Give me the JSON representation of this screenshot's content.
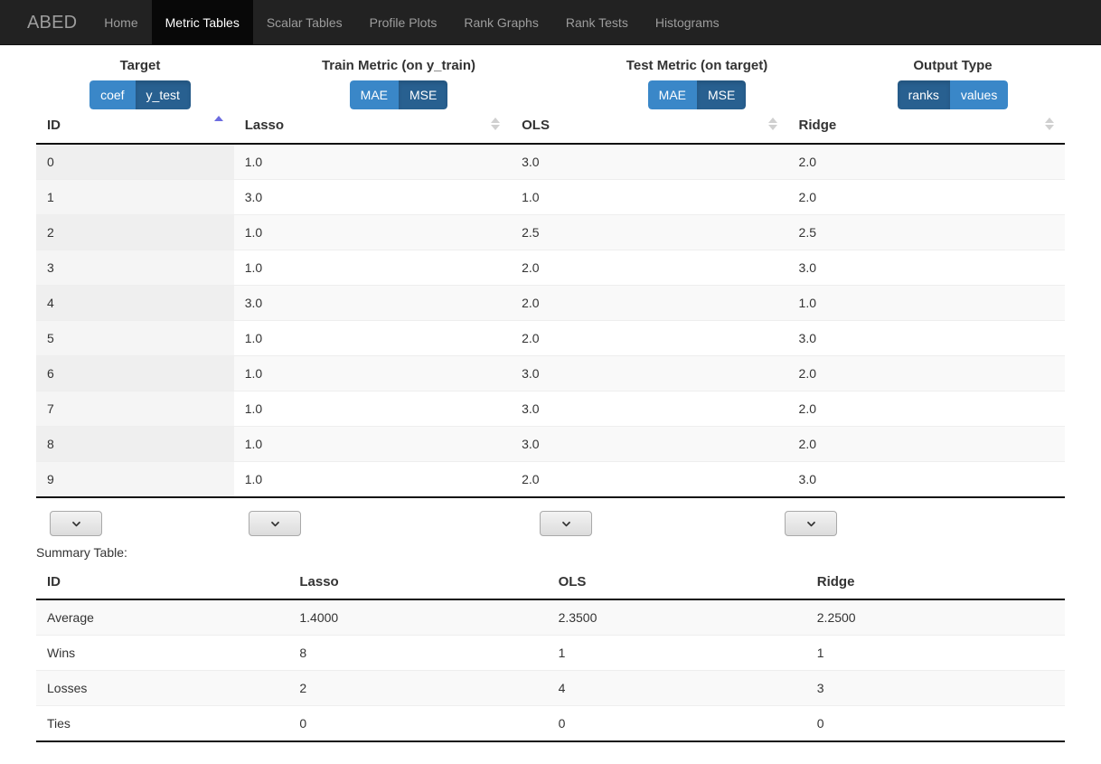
{
  "navbar": {
    "brand": "ABED",
    "items": [
      {
        "label": "Home",
        "active": false
      },
      {
        "label": "Metric Tables",
        "active": true
      },
      {
        "label": "Scalar Tables",
        "active": false
      },
      {
        "label": "Profile Plots",
        "active": false
      },
      {
        "label": "Rank Graphs",
        "active": false
      },
      {
        "label": "Rank Tests",
        "active": false
      },
      {
        "label": "Histograms",
        "active": false
      }
    ]
  },
  "colors": {
    "navbar_bg": "#222222",
    "navbar_active_bg": "#080808",
    "btn_default": "#3a87c8",
    "btn_selected": "#286090",
    "sort_active": "#6c6ce0"
  },
  "controls": [
    {
      "name": "target",
      "label": "Target",
      "options": [
        {
          "label": "coef",
          "selected": false
        },
        {
          "label": "y_test",
          "selected": true
        }
      ]
    },
    {
      "name": "train-metric",
      "label": "Train Metric (on y_train)",
      "options": [
        {
          "label": "MAE",
          "selected": false
        },
        {
          "label": "MSE",
          "selected": true
        }
      ]
    },
    {
      "name": "test-metric",
      "label": "Test Metric (on target)",
      "options": [
        {
          "label": "MAE",
          "selected": false
        },
        {
          "label": "MSE",
          "selected": true
        }
      ]
    },
    {
      "name": "output-type",
      "label": "Output Type",
      "options": [
        {
          "label": "ranks",
          "selected": true
        },
        {
          "label": "values",
          "selected": false
        }
      ]
    }
  ],
  "metric_table": {
    "columns": [
      {
        "label": "ID",
        "sort": "asc"
      },
      {
        "label": "Lasso",
        "sort": "none"
      },
      {
        "label": "OLS",
        "sort": "none"
      },
      {
        "label": "Ridge",
        "sort": "none"
      }
    ],
    "rows": [
      {
        "id": "0",
        "lasso": "1.0",
        "ols": "3.0",
        "ridge": "2.0"
      },
      {
        "id": "1",
        "lasso": "3.0",
        "ols": "1.0",
        "ridge": "2.0"
      },
      {
        "id": "2",
        "lasso": "1.0",
        "ols": "2.5",
        "ridge": "2.5"
      },
      {
        "id": "3",
        "lasso": "1.0",
        "ols": "2.0",
        "ridge": "3.0"
      },
      {
        "id": "4",
        "lasso": "3.0",
        "ols": "2.0",
        "ridge": "1.0"
      },
      {
        "id": "5",
        "lasso": "1.0",
        "ols": "2.0",
        "ridge": "3.0"
      },
      {
        "id": "6",
        "lasso": "1.0",
        "ols": "3.0",
        "ridge": "2.0"
      },
      {
        "id": "7",
        "lasso": "1.0",
        "ols": "3.0",
        "ridge": "2.0"
      },
      {
        "id": "8",
        "lasso": "1.0",
        "ols": "3.0",
        "ridge": "2.0"
      },
      {
        "id": "9",
        "lasso": "1.0",
        "ols": "2.0",
        "ridge": "3.0"
      }
    ],
    "filters": [
      {
        "name": "filter-id",
        "value": ""
      },
      {
        "name": "filter-lasso",
        "value": ""
      },
      {
        "name": "filter-ols",
        "value": ""
      },
      {
        "name": "filter-ridge",
        "value": ""
      }
    ]
  },
  "summary": {
    "caption": "Summary Table:",
    "columns": [
      "ID",
      "Lasso",
      "OLS",
      "Ridge"
    ],
    "rows": [
      {
        "id": "Average",
        "lasso": "1.4000",
        "ols": "2.3500",
        "ridge": "2.2500"
      },
      {
        "id": "Wins",
        "lasso": "8",
        "ols": "1",
        "ridge": "1"
      },
      {
        "id": "Losses",
        "lasso": "2",
        "ols": "4",
        "ridge": "3"
      },
      {
        "id": "Ties",
        "lasso": "0",
        "ols": "0",
        "ridge": "0"
      }
    ]
  },
  "icons": {
    "sort_asc": "sort-ascending-icon",
    "sort_none": "sort-none-icon",
    "chevron": "chevron-down-icon"
  }
}
